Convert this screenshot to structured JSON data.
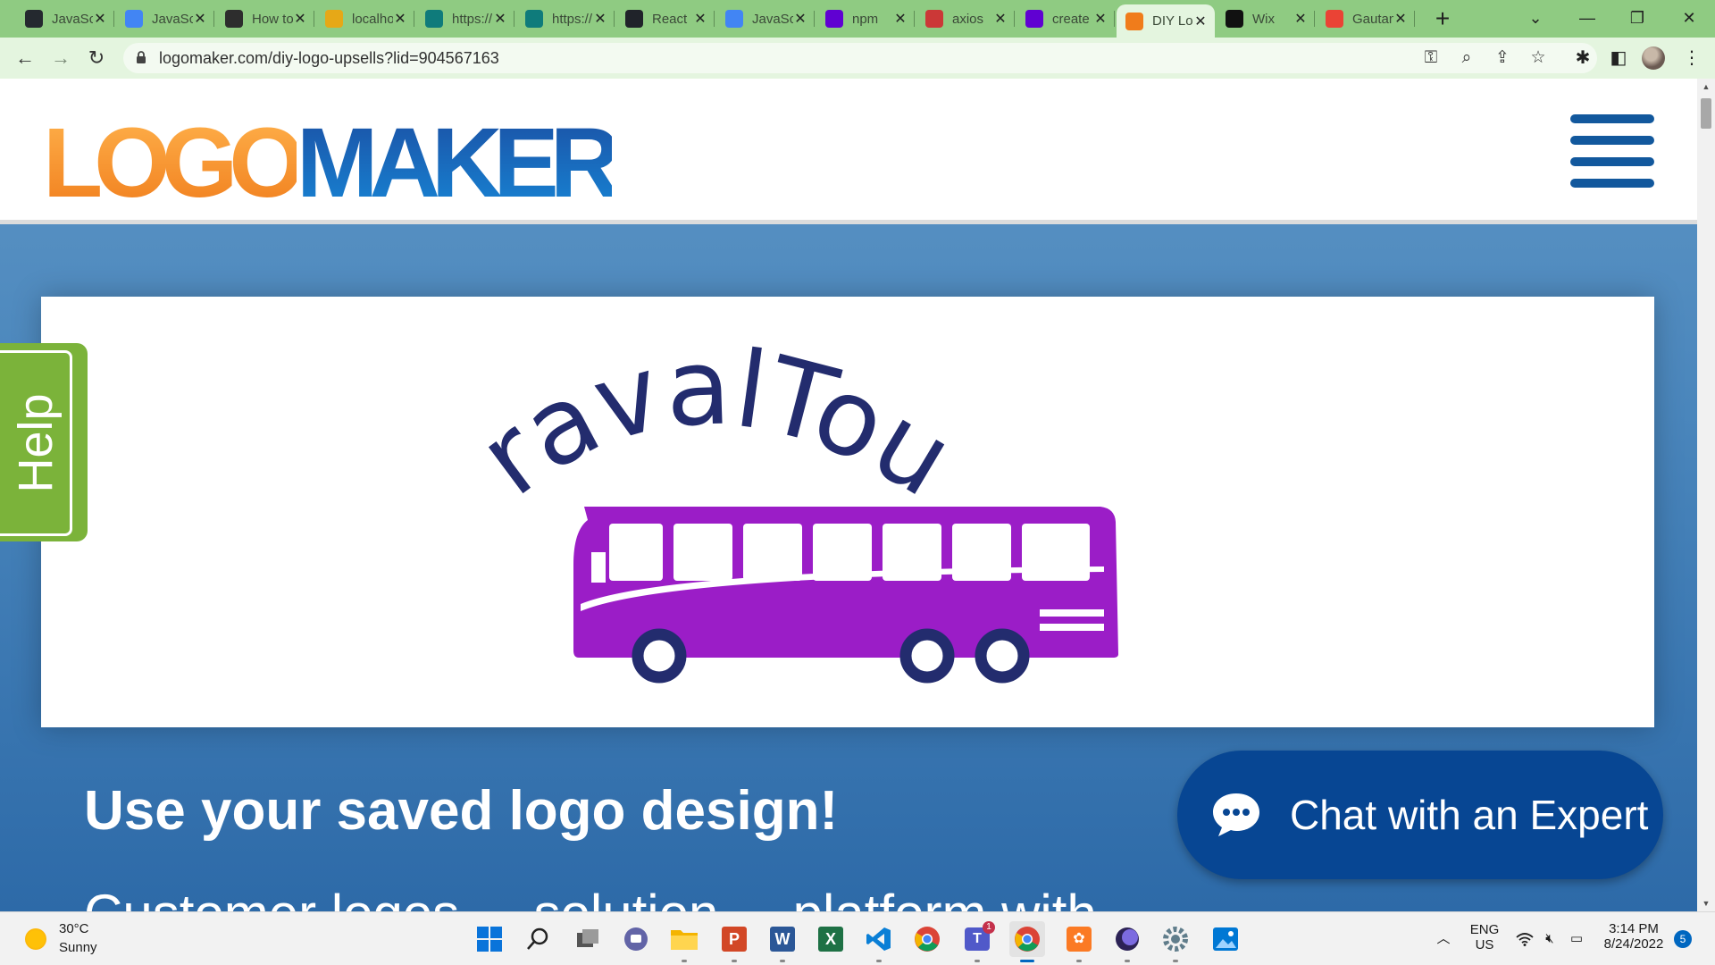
{
  "browser": {
    "tabs": [
      {
        "title": "JavaScript",
        "favicon": "github-icon",
        "color": "#24292f"
      },
      {
        "title": "JavaScript",
        "favicon": "docs-icon",
        "color": "#4285f4"
      },
      {
        "title": "How to",
        "favicon": "house-icon",
        "color": "#2d2d2d"
      },
      {
        "title": "localhost",
        "favicon": "phpmyadmin-icon",
        "color": "#e6a817"
      },
      {
        "title": "https://",
        "favicon": "sharepoint-icon",
        "color": "#0f7b7b"
      },
      {
        "title": "https://",
        "favicon": "sharepoint-icon",
        "color": "#0f7b7b"
      },
      {
        "title": "React",
        "favicon": "react-icon",
        "color": "#20232a"
      },
      {
        "title": "JavaScript",
        "favicon": "docs-icon",
        "color": "#4285f4"
      },
      {
        "title": "npm",
        "favicon": "yahoo-icon",
        "color": "#6001d2"
      },
      {
        "title": "axios",
        "favicon": "npm-icon",
        "color": "#cb3837"
      },
      {
        "title": "create",
        "favicon": "yahoo-icon",
        "color": "#6001d2"
      },
      {
        "title": "DIY Logo",
        "favicon": "logomaker-icon",
        "color": "#f07c1b",
        "active": true
      },
      {
        "title": "Wix",
        "favicon": "wix-icon",
        "color": "#111111"
      },
      {
        "title": "Gautam",
        "favicon": "gmail-icon",
        "color": "#ea4335"
      }
    ],
    "url": "logomaker.com/diy-logo-upsells?lid=904567163"
  },
  "site": {
    "logo_part1": "LOGO",
    "logo_part2": "MAKER",
    "brand_colors": {
      "orange": "#f07c1b",
      "blue": "#1b6fc0"
    }
  },
  "preview": {
    "brand_name": "PravalTour",
    "text_color": "#232c6e",
    "bus_color": "#9b1dc7",
    "wheel_color": "#232c6e"
  },
  "help_tab": {
    "label": "Help",
    "color": "#7bb33a"
  },
  "content": {
    "headline": "Use your saved logo design!",
    "subline": "Customer logos ... solution ... platform with ... "
  },
  "chat": {
    "label": "Chat with an Expert",
    "color": "#074693"
  },
  "taskbar": {
    "weather_temp": "30°C",
    "weather_desc": "Sunny",
    "language_top": "ENG",
    "language_bottom": "US",
    "time": "3:14 PM",
    "date": "8/24/2022",
    "notification_count": "5",
    "teams_badge": "1"
  }
}
